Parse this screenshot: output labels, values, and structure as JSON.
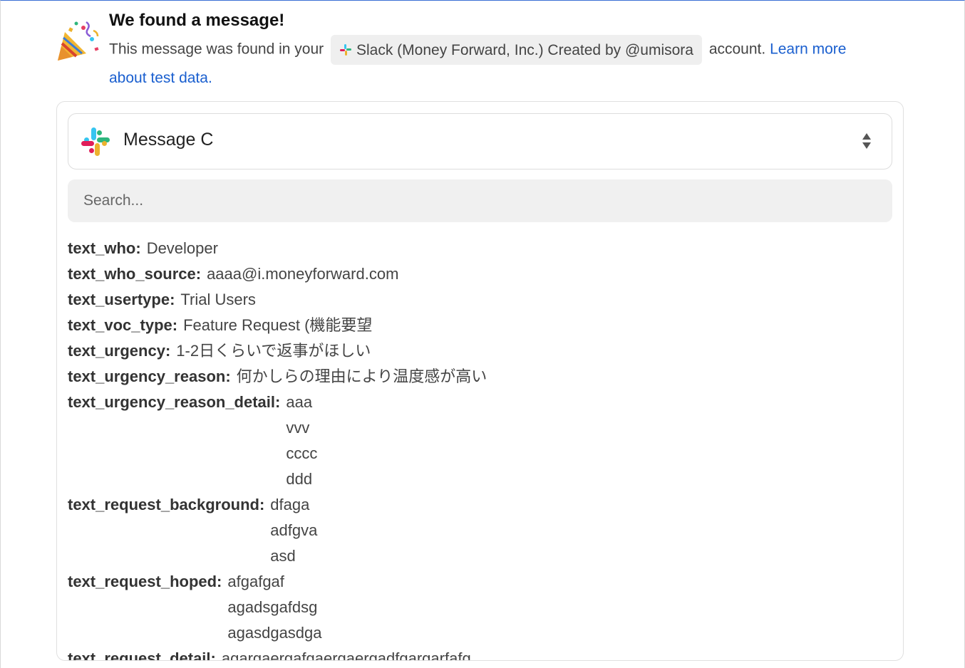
{
  "notice": {
    "title": "We found a message!",
    "text_before": "This message was found in your",
    "account_label": "Slack (Money Forward, Inc.) Created by @umisora",
    "text_after": "account.",
    "link": "Learn more about test data."
  },
  "selector": {
    "label": "Message C"
  },
  "search": {
    "placeholder": "Search..."
  },
  "fields": [
    {
      "key": "text_who:",
      "lines": [
        "Developer"
      ]
    },
    {
      "key": "text_who_source:",
      "lines": [
        "aaaa@i.moneyforward.com"
      ]
    },
    {
      "key": "text_usertype:",
      "lines": [
        "Trial Users"
      ]
    },
    {
      "key": "text_voc_type:",
      "lines": [
        "Feature Request (機能要望"
      ]
    },
    {
      "key": "text_urgency:",
      "lines": [
        "1-2日くらいで返事がほしい"
      ]
    },
    {
      "key": "text_urgency_reason:",
      "lines": [
        "何かしらの理由により温度感が高い"
      ]
    },
    {
      "key": "text_urgency_reason_detail:",
      "lines": [
        "aaa",
        "vvv",
        "cccc",
        "ddd"
      ]
    },
    {
      "key": "text_request_background:",
      "lines": [
        "dfaga",
        "adfgva",
        "asd"
      ]
    },
    {
      "key": "text_request_hoped:",
      "lines": [
        "afgafgaf",
        "agadsgafdsg",
        "agasdgasdga"
      ]
    },
    {
      "key": "text_request_detail:",
      "lines": [
        "agargaergafgaergaergadfgargarfafg"
      ]
    }
  ],
  "colors": {
    "link": "#1a5fcf",
    "slack_blue": "#36C5F0",
    "slack_green": "#2EB67D",
    "slack_red": "#E01E5A",
    "slack_yellow": "#ECB22E"
  },
  "icons": {
    "celebration": "party-popper-icon",
    "brand": "slack-logo-icon",
    "sort": "sort-arrows-icon"
  }
}
